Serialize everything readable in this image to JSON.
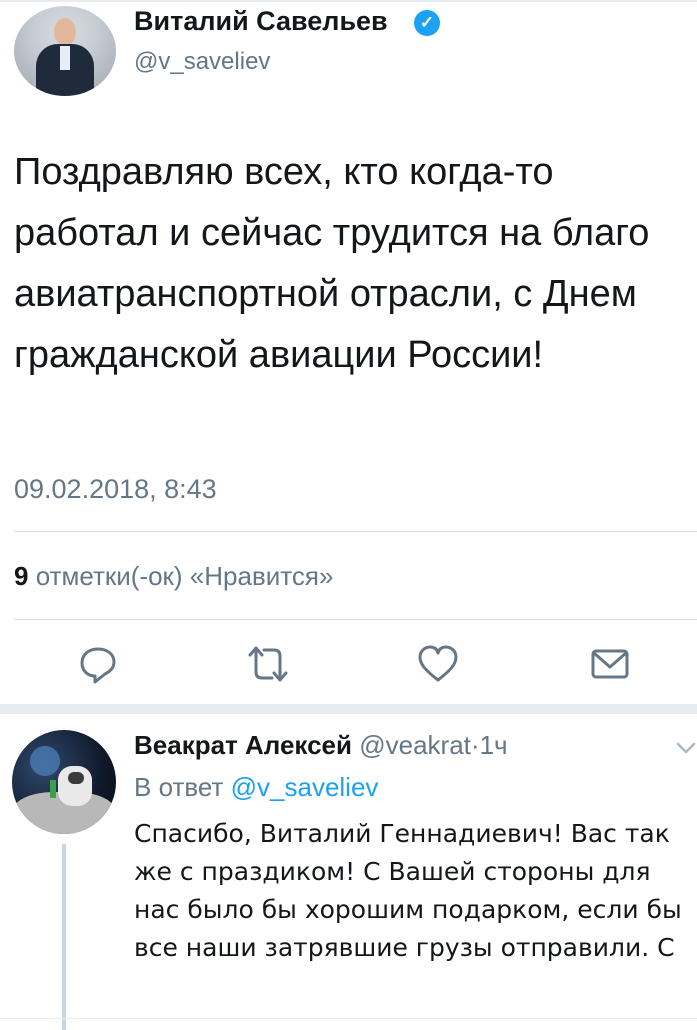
{
  "tweet": {
    "author_name": "Виталий Савельев",
    "handle": "@v_saveliev",
    "text": "Поздравляю всех, кто когда-то работал и сейчас трудится на благо авиатранспортной отрасли, с Днем гражданской авиации России!",
    "timestamp": "09.02.2018, 8:43",
    "likes_count": "9",
    "likes_label": "отметки(-ок) «Нравится»"
  },
  "actions": {
    "reply_icon": "reply-icon",
    "retweet_icon": "retweet-icon",
    "like_icon": "heart-icon",
    "message_icon": "envelope-icon"
  },
  "reply": {
    "author_name": "Веакрат Алексей",
    "handle": "@veakrat",
    "separator": "·",
    "time": "1ч",
    "reply_to_prefix": "В ответ",
    "reply_to_handle": "@v_saveliev",
    "text": "Спасибо, Виталий Геннадиевич! Вас так же с праздиком! С Вашей стороны для нас было бы хорошим подарком, если бы все наши затрявшие грузы отправили. С"
  },
  "colors": {
    "accent": "#1da1f2",
    "secondary_text": "#657786",
    "primary_text": "#14171a",
    "divider": "#e6ecf0"
  }
}
